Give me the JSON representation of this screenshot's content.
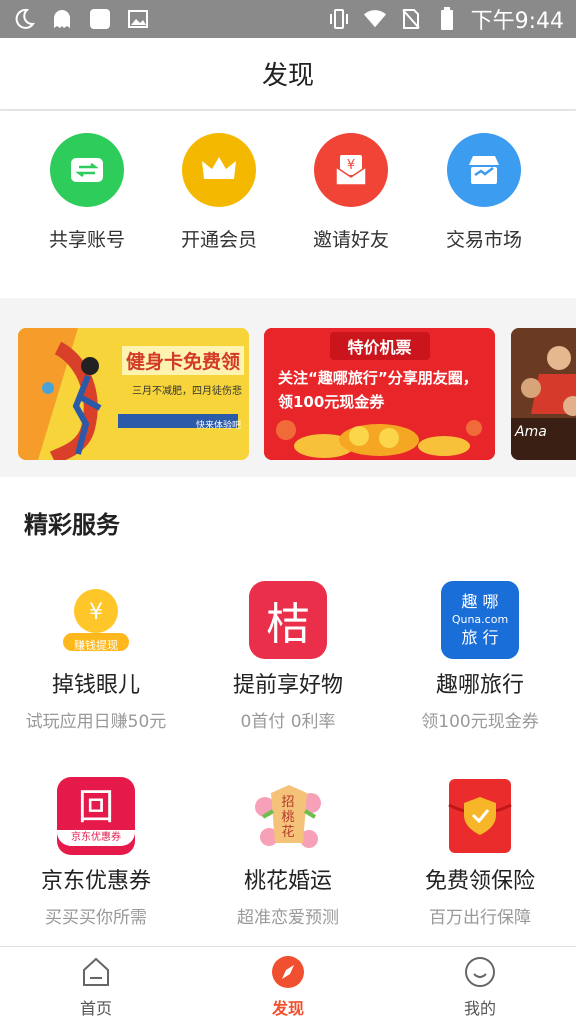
{
  "status_bar": {
    "time": "下午9:44",
    "icons": [
      "moon-icon",
      "ghost-icon",
      "app-icon",
      "image-icon",
      "vibrate-icon",
      "wifi-icon",
      "no-sim-icon",
      "battery-icon"
    ]
  },
  "header": {
    "title": "发现"
  },
  "quick_actions": [
    {
      "label": "共享账号",
      "icon": "share-account-icon",
      "color": "#2ecc5a"
    },
    {
      "label": "开通会员",
      "icon": "crown-icon",
      "color": "#f5b800"
    },
    {
      "label": "邀请好友",
      "icon": "red-envelope-icon",
      "color": "#f04436"
    },
    {
      "label": "交易市场",
      "icon": "market-icon",
      "color": "#3c9cf0"
    }
  ],
  "banners": [
    {
      "title": "健身卡免费领",
      "subtitle": "三月不减肥，四月徒伤悲",
      "tag": "快来体验吧"
    },
    {
      "title": "特价机票",
      "text": "关注“趣哪旅行”分享朋友圈，领100元现金券"
    },
    {
      "text": "Ama"
    }
  ],
  "services": {
    "title": "精彩服务",
    "items": [
      {
        "name": "掉钱眼儿",
        "sub": "试玩应用日赚50元",
        "icon": "coin-withdraw-icon",
        "badge": "赚钱提现"
      },
      {
        "name": "提前享好物",
        "sub": "0首付 0利率",
        "icon": "jie-icon",
        "glyph": "桔"
      },
      {
        "name": "趣哪旅行",
        "sub": "领100元现金券",
        "icon": "quna-icon",
        "lines": [
          "趣 哪",
          "Quna.com",
          "旅 行"
        ]
      },
      {
        "name": "京东优惠券",
        "sub": "买买买你所需",
        "icon": "jd-coupon-icon",
        "glyph": "回",
        "badge": "京东优惠券"
      },
      {
        "name": "桃花婚运",
        "sub": "超准恋爱预测",
        "icon": "peach-blossom-icon",
        "glyph": "招桃花"
      },
      {
        "name": "免费领保险",
        "sub": "百万出行保障",
        "icon": "insurance-icon"
      }
    ]
  },
  "bottom_nav": [
    {
      "label": "首页",
      "icon": "home-icon",
      "active": false
    },
    {
      "label": "发现",
      "icon": "compass-icon",
      "active": true
    },
    {
      "label": "我的",
      "icon": "smile-icon",
      "active": false
    }
  ],
  "colors": {
    "accent": "#f0502f",
    "status_bar": "#8a8a8a"
  }
}
